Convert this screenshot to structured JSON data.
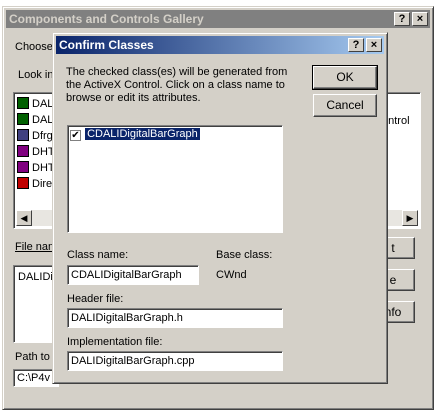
{
  "gallery": {
    "title": "Components and Controls Gallery",
    "help_btn": "?",
    "close_btn": "×",
    "choose_label": "Choose",
    "look_in_label": "Look in",
    "items": [
      {
        "label": "DALI",
        "icon": "grid-control-icon",
        "color": "#006000"
      },
      {
        "label": "DAL",
        "icon": "phone-control-icon",
        "color": "#006000"
      },
      {
        "label": "Dfrg",
        "icon": "disk-control-icon",
        "color": "#404080"
      },
      {
        "label": "DHT",
        "icon": "html-control-icon",
        "color": "#800080"
      },
      {
        "label": "DHT",
        "icon": "html-control-icon",
        "color": "#800080"
      },
      {
        "label": "Dire",
        "icon": "direction-control-icon",
        "color": "#c00000"
      }
    ],
    "right_fragment": "ontrol",
    "file_name_label": "File nam",
    "desc_text": "DALIDi",
    "insert_btn": "t",
    "close_frag_btn": "e",
    "more_info_btn": "nfo",
    "path_label": "Path to",
    "path_value": "C:\\P4v"
  },
  "dialog": {
    "title": "Confirm Classes",
    "help_btn": "?",
    "close_btn": "×",
    "message": "The checked class(es) will be generated from the ActiveX Control.  Click on a class name to browse or edit its attributes.",
    "ok_label": "OK",
    "cancel_label": "Cancel",
    "class_list": [
      {
        "name": "CDALIDigitalBarGraph",
        "checked": true,
        "selected": true
      }
    ],
    "class_name_label": "Class name:",
    "class_name_value": "CDALIDigitalBarGraph",
    "base_class_label": "Base class:",
    "base_class_value": "CWnd",
    "header_file_label": "Header file:",
    "header_file_value": "DALIDigitalBarGraph.h",
    "impl_file_label": "Implementation file:",
    "impl_file_value": "DALIDigitalBarGraph.cpp"
  }
}
